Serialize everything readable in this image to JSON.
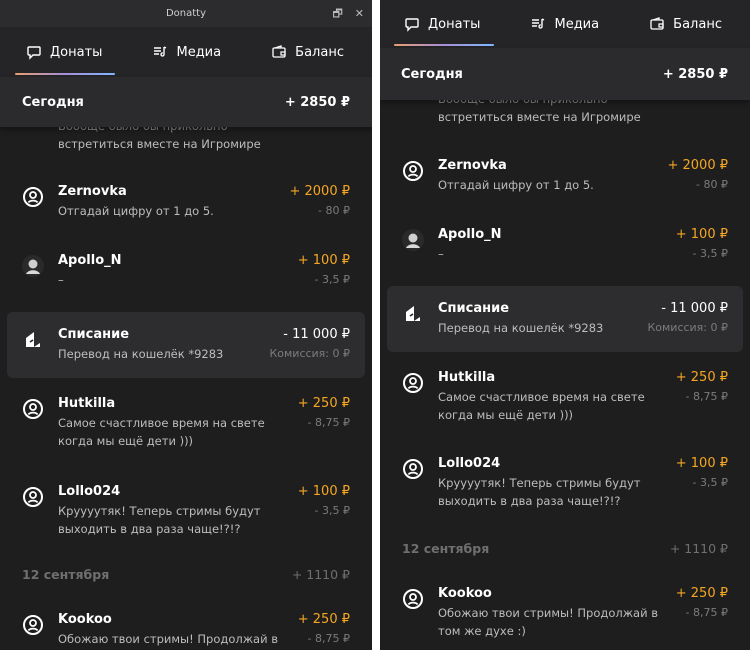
{
  "window_title": "Donatty",
  "window_buttons": [
    "🗗",
    "✕"
  ],
  "tabs": [
    {
      "label": "Донаты",
      "icon": "chat-bubble-icon"
    },
    {
      "label": "Медиа",
      "icon": "music-list-icon"
    },
    {
      "label": "Баланс",
      "icon": "wallet-icon"
    }
  ],
  "today": {
    "label": "Сегодня",
    "total": "+ 2850 ₽"
  },
  "partial_message": [
    "Вообще было бы прикольно",
    "встретиться вместе на Игромире"
  ],
  "donations": [
    {
      "name": "Zernovka",
      "message": "Отгадай цифру от 1 до 5.",
      "amount": "+ 2000 ₽",
      "fee": "- 80 ₽",
      "avatar": "user-icon"
    },
    {
      "name": "Apollo_N",
      "message": "–",
      "amount": "+ 100 ₽",
      "fee": "- 3,5 ₽",
      "avatar": "photo-avatar"
    },
    {
      "name": "Списание",
      "message": "Перевод на кошелёк *9283",
      "amount": "- 11 000 ₽",
      "fee": "Комиссия: 0 ₽",
      "avatar": "withdraw-icon"
    },
    {
      "name": "Hutkilla",
      "message": "Самое счастливое время на свете когда мы ещё дети )))",
      "amount": "+ 250 ₽",
      "fee": "- 8,75 ₽",
      "avatar": "user-icon"
    },
    {
      "name": "Lollo024",
      "message": "Круууутяк! Теперь стримы будут выходить в два раза чаще!?!?",
      "amount": "+ 100 ₽",
      "fee": "- 3,5 ₽",
      "avatar": "user-icon"
    }
  ],
  "date_group": {
    "label": "12 сентября",
    "total": "+ 1110 ₽"
  },
  "kookoo": {
    "name": "Kookoo",
    "message_left": "Обожаю твои стримы! Продолжай в",
    "message_right": "Обожаю твои стримы! Продолжай в том же духе :)",
    "amount": "+ 250 ₽",
    "fee": "- 8,75 ₽"
  },
  "colors": {
    "background": "#1e1e1f",
    "accent_amount": "#f5a623",
    "muted": "#7b7b7b",
    "tab_underline": [
      "#e7a06e",
      "#a78fd8",
      "#7fb8ff"
    ]
  }
}
